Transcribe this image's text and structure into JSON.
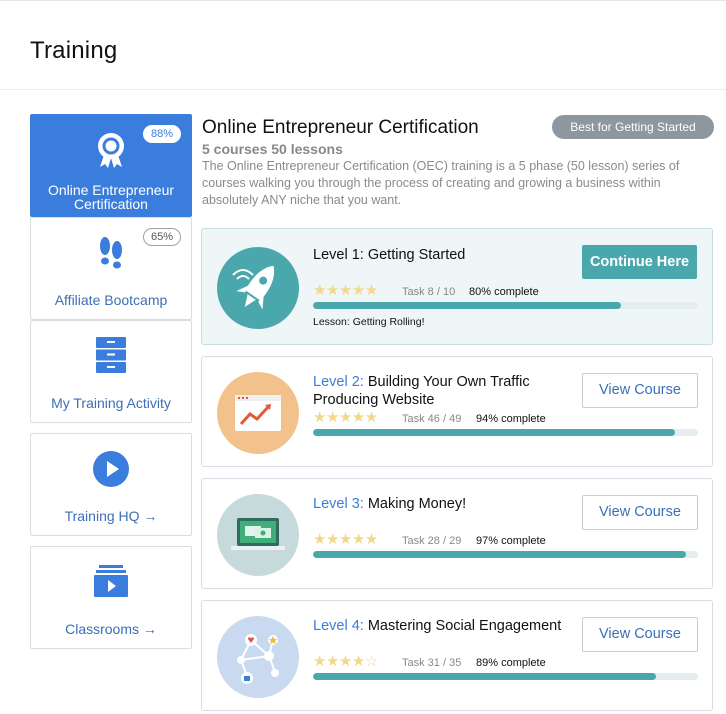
{
  "header": {
    "title": "Training"
  },
  "sidebar": {
    "items": [
      {
        "label": "Online Entrepreneur Certification",
        "percent": "88%",
        "icon": "award-ribbon-icon"
      },
      {
        "label": "Affiliate Bootcamp",
        "percent": "65%",
        "icon": "footprints-icon"
      },
      {
        "label": "My Training Activity",
        "icon": "file-cabinet-icon"
      },
      {
        "label": "Training HQ →",
        "icon": "play-icon"
      },
      {
        "label": "Classrooms →",
        "icon": "video-folder-icon"
      }
    ]
  },
  "main": {
    "title": "Online Entrepreneur Certification",
    "badge": "Best for Getting Started",
    "subtitle": "5 courses 50 lessons",
    "description": "The Online Entrepreneur Certification (OEC) training is a 5 phase (50 lesson) series of courses walking you through the process of creating and growing a business within absolutely ANY niche that you want."
  },
  "levels": [
    {
      "level_label": "Level 1:",
      "name": "Getting Started",
      "task": "Task 8 / 10",
      "complete": "80% complete",
      "progress": 0.8,
      "stars": "★★★★★",
      "lesson": "Lesson: Getting Rolling!",
      "button": "Continue Here",
      "icon": "rocket-icon"
    },
    {
      "level_label": "Level 2:",
      "name": "Building Your Own Traffic Producing Website",
      "task": "Task 46 / 49",
      "complete": "94% complete",
      "progress": 0.94,
      "stars": "★★★★★",
      "button": "View Course",
      "icon": "website-growth-icon"
    },
    {
      "level_label": "Level 3:",
      "name": "Making Money!",
      "task": "Task 28 / 29",
      "complete": "97% complete",
      "progress": 0.97,
      "stars": "★★★★★",
      "button": "View Course",
      "icon": "laptop-money-icon"
    },
    {
      "level_label": "Level 4:",
      "name": "Mastering Social Engagement",
      "task": "Task 31 / 35",
      "complete": "89% complete",
      "progress": 0.89,
      "stars": "★★★★☆",
      "button": "View Course",
      "icon": "social-network-icon"
    }
  ],
  "colors": {
    "accent": "#3b7ddd",
    "teal": "#4aa8ad",
    "badge": "#8e969f"
  }
}
